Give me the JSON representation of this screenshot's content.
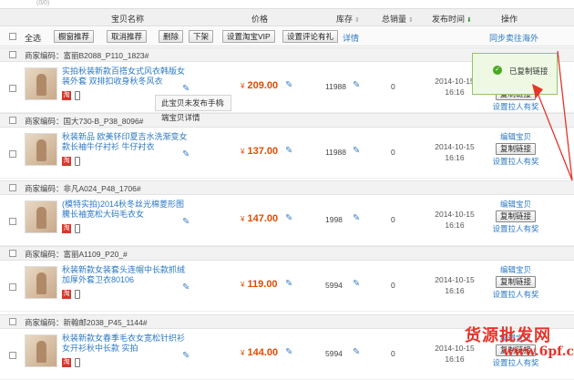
{
  "header": {
    "top_fragment": "(0/0)",
    "col_name": "宝贝名称",
    "col_price": "价格",
    "col_stock": "库存",
    "col_sales": "总销量",
    "col_date": "发布时间",
    "col_ops": "操作"
  },
  "toolbar": {
    "select_all": "全选",
    "btn_recommend": "橱窗推荐",
    "btn_cancel_recommend": "取消推荐",
    "btn_delete": "删除",
    "btn_delist": "下架",
    "btn_set_vip": "设置淘宝VIP",
    "btn_set_review": "设置评论有礼",
    "details": "详情",
    "sync_overseas": "同步卖往海外"
  },
  "copied_tip": {
    "text": "已复制链接"
  },
  "popover": {
    "text": "此宝贝未发布手机端宝贝详情",
    "close": "✕"
  },
  "ops_labels": {
    "edit": "编辑宝贝",
    "copy_link": "复制链接",
    "set_pull": "设置拉人有奖"
  },
  "products": [
    {
      "merchant_code": "商家编码：富丽B2088_P110_1823#",
      "title": "实拍秋装新款百搭女式风衣韩版女装外套 双排扣收身秋冬风衣",
      "price_symbol": "¥",
      "price": "209.00",
      "stock": "11988",
      "sales": "0",
      "date": "2014-10-15",
      "time": "16:16"
    },
    {
      "merchant_code": "商家编码：国大730-B_P38_8096#",
      "title": "秋装新品 欧美钚印夏吉水洗渐变女款长袖牛仔衬衫 牛仔衬衣",
      "price_symbol": "¥",
      "price": "137.00",
      "stock": "11988",
      "sales": "0",
      "date": "2014-10-15",
      "time": "16:16"
    },
    {
      "merchant_code": "商家编码：非凡A024_P48_1706#",
      "title": "(模特实拍)2014秋冬丝光棉菱形图騰长袖宽松大码毛衣女",
      "price_symbol": "¥",
      "price": "147.00",
      "stock": "1998",
      "sales": "0",
      "date": "2014-10-15",
      "time": "16:16"
    },
    {
      "merchant_code": "商家编码：富丽A1109_P20_#",
      "title": "秋装新款女装套头连帽中长款抓绒加厚外套卫衣80106",
      "price_symbol": "¥",
      "price": "119.00",
      "stock": "5994",
      "sales": "0",
      "date": "2014-10-15",
      "time": "16:16"
    },
    {
      "merchant_code": "商家编码：新翰邮2038_P45_1144#",
      "title": "秋装新款女春季毛衣女宽松针织衫女开衫秋中长款 实拍",
      "price_symbol": "¥",
      "price": "144.00",
      "stock": "5994",
      "sales": "0",
      "date": "2014-10-15",
      "time": "16:16"
    }
  ],
  "watermark": {
    "line1": "货源批发网",
    "line2": "www.6pf.cn"
  },
  "colors": {
    "link": "#2b78c5",
    "price": "#e04b00",
    "arrow": "#e5342b",
    "success_bg": "#eef8e3"
  }
}
